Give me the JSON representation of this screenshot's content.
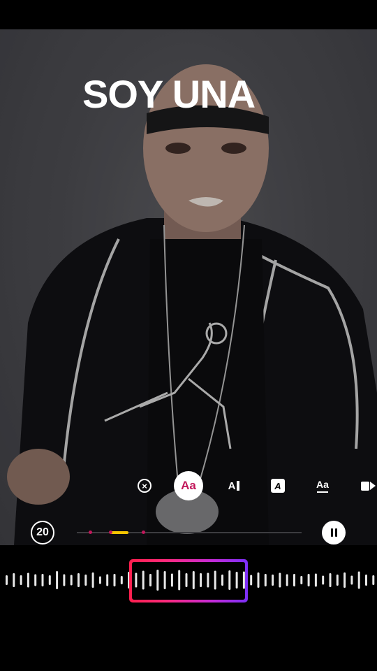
{
  "story": {
    "overlay_text": "SOY UNA"
  },
  "text_tools": [
    {
      "name": "close",
      "glyph": "×"
    },
    {
      "name": "font-style",
      "glyph": "Aa",
      "active": true
    },
    {
      "name": "typewriter",
      "glyph": "A"
    },
    {
      "name": "boxed-text",
      "glyph": "A"
    },
    {
      "name": "underline-text",
      "glyph": "Aa"
    },
    {
      "name": "more",
      "glyph": ""
    }
  ],
  "playback": {
    "duration_label": "20",
    "selection_start_fraction": 0.15,
    "selection_end_fraction": 0.23
  },
  "colors": {
    "accent_pink": "#c2185b",
    "selection_yellow": "#f5c400",
    "gradient_start": "#ff1f4e",
    "gradient_end": "#7b2ff7"
  }
}
